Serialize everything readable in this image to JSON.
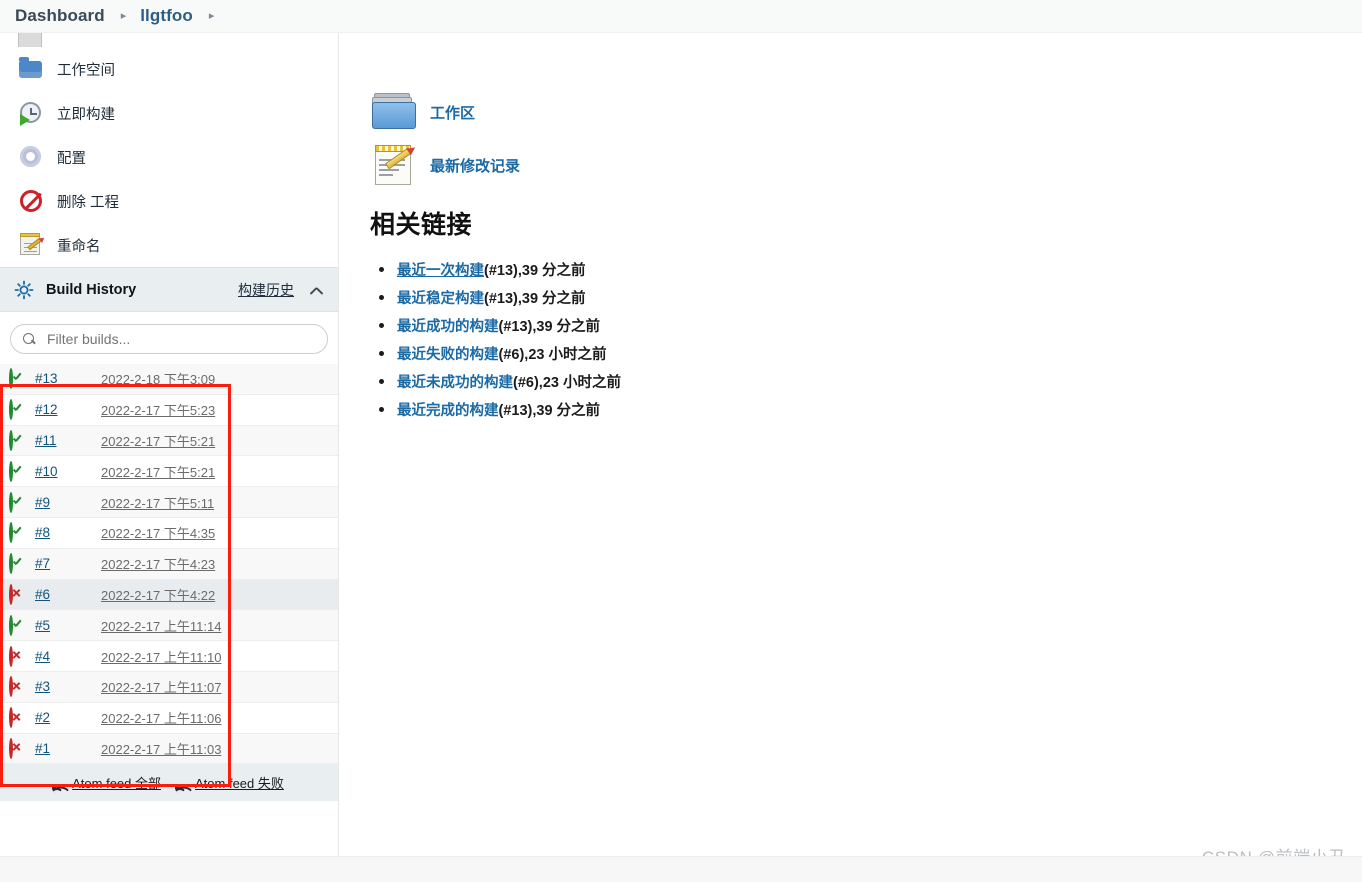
{
  "breadcrumb": {
    "items": [
      {
        "label": "Dashboard",
        "sep": "▸"
      },
      {
        "label": "llgtfoo",
        "sep": "▸"
      }
    ],
    "dashboard_label": "Dashboard",
    "project_label": "llgtfoo",
    "separator": "▸"
  },
  "sidebar": {
    "tasks": [
      {
        "label": "",
        "icon": "folder-grey-icon",
        "clipped": true
      },
      {
        "label": "工作空间",
        "icon": "workspace-folder-icon"
      },
      {
        "label": "立即构建",
        "icon": "build-now-icon"
      },
      {
        "label": "配置",
        "icon": "gear-icon"
      },
      {
        "label": "删除 工程",
        "icon": "delete-project-icon"
      },
      {
        "label": "重命名",
        "icon": "rename-icon"
      }
    ],
    "build_history": {
      "title": "Build History",
      "zh_link": "构建历史",
      "collapse_icon": "chevron-up-icon",
      "sun_icon": "weather-sun-icon",
      "filter_placeholder": "Filter builds...",
      "filter_value": "",
      "search_icon": "search-icon",
      "builds": [
        {
          "number": "#13",
          "date": "2022-2-18 下午3:09",
          "status": "success"
        },
        {
          "number": "#12",
          "date": "2022-2-17 下午5:23",
          "status": "success"
        },
        {
          "number": "#11",
          "date": "2022-2-17 下午5:21",
          "status": "success"
        },
        {
          "number": "#10",
          "date": "2022-2-17 下午5:21",
          "status": "success"
        },
        {
          "number": "#9",
          "date": "2022-2-17 下午5:11",
          "status": "success"
        },
        {
          "number": "#8",
          "date": "2022-2-17 下午4:35",
          "status": "success"
        },
        {
          "number": "#7",
          "date": "2022-2-17 下午4:23",
          "status": "success"
        },
        {
          "number": "#6",
          "date": "2022-2-17 下午4:22",
          "status": "failure",
          "highlighted": true
        },
        {
          "number": "#5",
          "date": "2022-2-17 上午11:14",
          "status": "success"
        },
        {
          "number": "#4",
          "date": "2022-2-17 上午11:10",
          "status": "failure"
        },
        {
          "number": "#3",
          "date": "2022-2-17 上午11:07",
          "status": "failure"
        },
        {
          "number": "#2",
          "date": "2022-2-17 上午11:06",
          "status": "failure"
        },
        {
          "number": "#1",
          "date": "2022-2-17 上午11:03",
          "status": "failure"
        }
      ],
      "feeds": [
        {
          "label": "Atom feed 全部",
          "icon": "rss-icon"
        },
        {
          "label": "Atom feed 失败",
          "icon": "rss-icon"
        }
      ]
    }
  },
  "scroll_widget": {
    "buttons": [
      {
        "name": "scroll-to-top-button",
        "icon": "arrow-up-to-bar-icon"
      },
      {
        "name": "scroll-up-button",
        "icon": "arrow-up-icon"
      },
      {
        "name": "scroll-down-button",
        "icon": "arrow-down-icon"
      }
    ]
  },
  "main": {
    "actions": [
      {
        "label": "工作区",
        "icon": "workspace-folder-icon"
      },
      {
        "label": "最新修改记录",
        "icon": "changes-note-icon"
      }
    ],
    "related_links": {
      "title": "相关链接",
      "items": [
        {
          "link": "最近一次构建",
          "suffix": "(#13),39 分之前"
        },
        {
          "link": "最近稳定构建",
          "suffix": "(#13),39 分之前"
        },
        {
          "link": "最近成功的构建",
          "suffix": "(#13),39 分之前"
        },
        {
          "link": "最近失败的构建",
          "suffix": "(#6),23 小时之前"
        },
        {
          "link": "最近未成功的构建",
          "suffix": "(#6),23 小时之前"
        },
        {
          "link": "最近完成的构建",
          "suffix": "(#13),39 分之前"
        }
      ]
    }
  },
  "watermark": "CSDN @前端小丑",
  "colors": {
    "link": "#1b6aa5",
    "success": "#1f8a2f",
    "failure": "#c62828",
    "annotation": "#fc1d10",
    "panel_header_bg": "#e9eef1"
  }
}
